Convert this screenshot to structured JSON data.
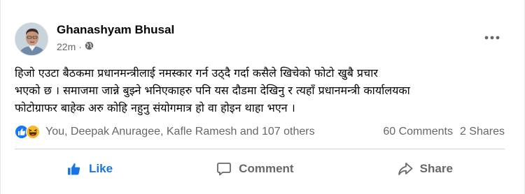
{
  "post": {
    "author": "Ghanashyam Bhusal",
    "time": "22m",
    "separator": "·",
    "privacy_icon": "globe-icon",
    "more_icon": "more-icon",
    "text_lines": [
      "हिजो एउटा बैठकमा प्रधानमन्त्रीलाई नमस्कार गर्न उठ्दै गर्दा कसैले खिचेको फोटो खुबै प्रचार",
      "भएको छ । समाजमा जान्ने बुझ्ने भनिएकाहरु पनि यस दौडमा देखिनु र त्यहाँ प्रधानमन्त्री कार्यालयका",
      "फोटोग्राफर बाहेक अरु कोहि नहुनु संयोगमात्र हो वा होइन थाहा भएन ।"
    ]
  },
  "reactions": {
    "icons": [
      "like-reaction-icon",
      "haha-reaction-icon"
    ],
    "people": "You, Deepak Anuragee, Kafle Ramesh and 107 others",
    "comments": "60 Comments",
    "shares": "2 Shares"
  },
  "actions": {
    "like": "Like",
    "comment": "Comment",
    "share": "Share"
  },
  "colors": {
    "like_blue": "#1b74e4",
    "secondary_text": "#65676b",
    "haha_yellow": "#f7b928"
  }
}
